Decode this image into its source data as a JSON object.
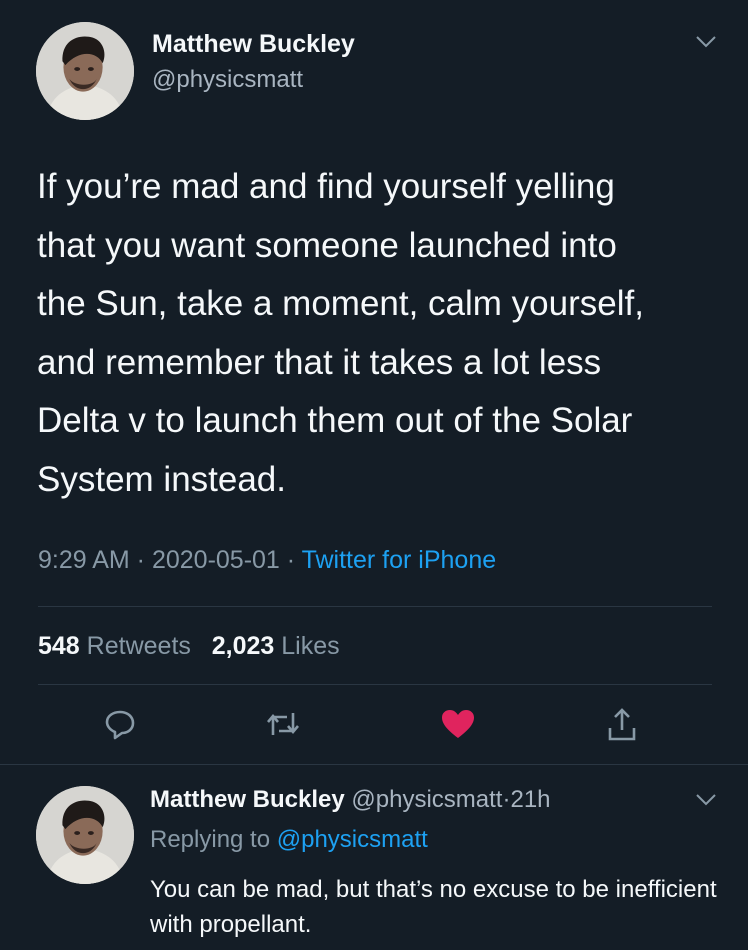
{
  "tweet": {
    "author_name": "Matthew Buckley",
    "author_handle": "@physicsmatt",
    "text": "If you’re mad and find yourself yelling\nthat you want someone launched into\nthe Sun, take a moment, calm yourself,\nand remember that it takes a lot less\nDelta v to launch them out of the Solar\nSystem instead.",
    "time": "9:29 AM",
    "date": "2020-05-01",
    "source": "Twitter for iPhone",
    "separator": " · ",
    "retweets_count": "548",
    "retweets_label": "Retweets",
    "likes_count": "2,023",
    "likes_label": "Likes"
  },
  "actions": [
    {
      "name": "reply",
      "icon": "reply-icon"
    },
    {
      "name": "retweet",
      "icon": "retweet-icon"
    },
    {
      "name": "like",
      "icon": "heart-icon",
      "color": "#e0245e"
    },
    {
      "name": "share",
      "icon": "share-icon"
    }
  ],
  "reply": {
    "author_name": "Matthew Buckley",
    "author_handle": "@physicsmatt",
    "time_ago": "21h",
    "time_separator": "·",
    "replying_label": "Replying to",
    "replying_to": "@physicsmatt",
    "text": "You can be mad, but that’s no excuse to be inefficient with propellant."
  },
  "colors": {
    "background": "#141d26",
    "text": "#f5f8fa",
    "secondary": "#8899a6",
    "link": "#1da1f2",
    "like": "#e0245e"
  }
}
